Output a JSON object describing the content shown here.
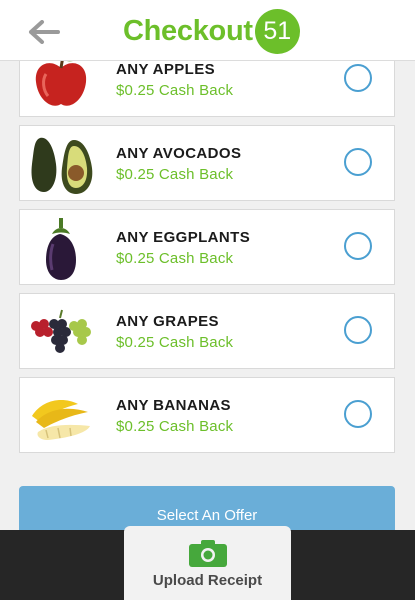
{
  "header": {
    "logo_text": "Checkout",
    "logo_badge": "51",
    "back_icon": "arrow-left-icon"
  },
  "offers": [
    {
      "name": "ANY APPLES",
      "cash": "$0.25 Cash Back",
      "icon": "apple-icon",
      "selected": false
    },
    {
      "name": "ANY AVOCADOS",
      "cash": "$0.25 Cash Back",
      "icon": "avocado-icon",
      "selected": false
    },
    {
      "name": "ANY EGGPLANTS",
      "cash": "$0.25 Cash Back",
      "icon": "eggplant-icon",
      "selected": false
    },
    {
      "name": "ANY GRAPES",
      "cash": "$0.25 Cash Back",
      "icon": "grapes-icon",
      "selected": false
    },
    {
      "name": "ANY BANANAS",
      "cash": "$0.25 Cash Back",
      "icon": "bananas-icon",
      "selected": false
    }
  ],
  "select_button": {
    "label": "Select An Offer"
  },
  "upload": {
    "label": "Upload Receipt",
    "icon": "camera-icon"
  },
  "colors": {
    "brand_green": "#6cbf2a",
    "radio_blue": "#4a9fd1",
    "button_blue": "#6aaed8",
    "bar_dark": "#262626"
  }
}
